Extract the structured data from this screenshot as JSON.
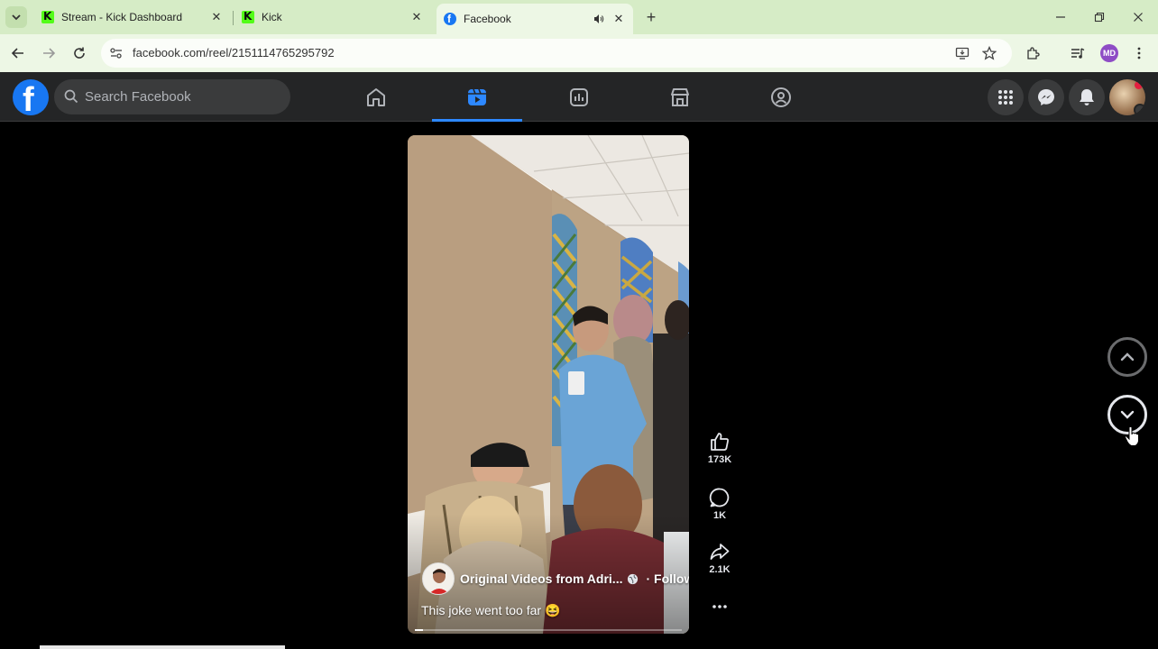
{
  "browser": {
    "tabs": [
      {
        "title": "Stream - Kick Dashboard",
        "icon": "kick-icon"
      },
      {
        "title": "Kick",
        "icon": "kick-icon"
      },
      {
        "title": "Facebook",
        "icon": "facebook-icon",
        "active": true,
        "audio": true
      }
    ],
    "url": "facebook.com/reel/2151114765295792",
    "profile_initials": "MD",
    "theme_color": "#d6ecc6"
  },
  "facebook": {
    "search_placeholder": "Search Facebook",
    "nav_tabs": [
      "home-icon",
      "video-icon",
      "feeds-icon",
      "marketplace-icon",
      "groups-icon"
    ],
    "active_nav": "video-icon",
    "accent": "#1877f2"
  },
  "reel": {
    "author": "Original Videos from Adri...",
    "follow_label": "· Follow",
    "caption": "This joke went too far 😆",
    "progress": 0.03
  },
  "actions": {
    "likes": "173K",
    "comments": "1K",
    "shares": "2.1K"
  }
}
